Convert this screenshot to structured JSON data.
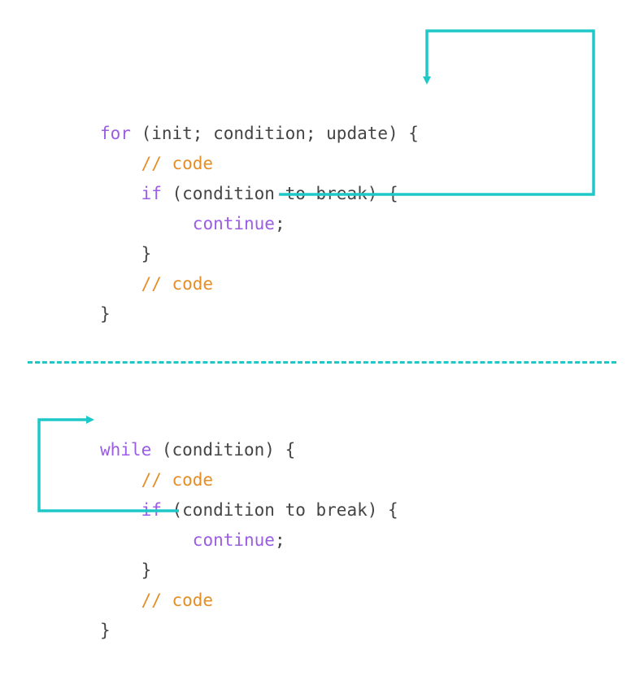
{
  "colors": {
    "keyword": "#9b5de5",
    "comment": "#e58e26",
    "arrow": "#1ec8c8",
    "text": "#444444"
  },
  "for_block": {
    "l1_for": "for",
    "l1_rest": " (init; condition; update) {",
    "l2_comment": "// code",
    "l3_if": "if",
    "l3_rest": " (condition to break) {",
    "l4_continue": "continue",
    "l4_semi": ";",
    "l5_close": "}",
    "l6_comment": "// code",
    "l7_close": "}"
  },
  "while_block": {
    "l1_while": "while",
    "l1_rest": " (condition) {",
    "l2_comment": "// code",
    "l3_if": "if",
    "l3_rest": " (condition to break) {",
    "l4_continue": "continue",
    "l4_semi": ";",
    "l5_close": "}",
    "l6_comment": "// code",
    "l7_close": "}"
  }
}
